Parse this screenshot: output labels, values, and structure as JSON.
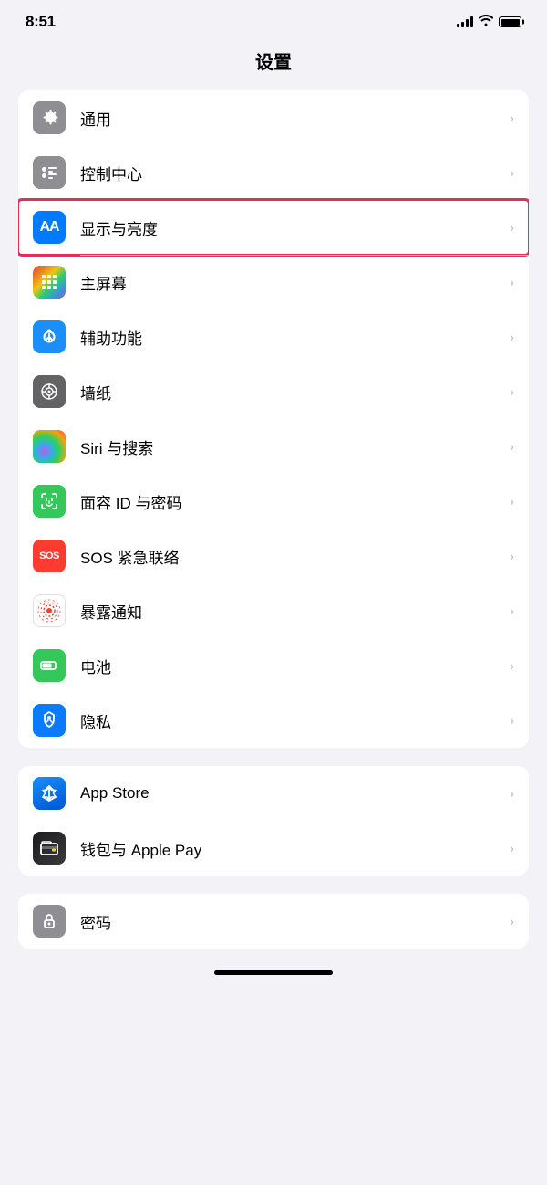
{
  "statusBar": {
    "time": "8:51"
  },
  "pageTitle": "设置",
  "group1": {
    "items": [
      {
        "id": "general",
        "label": "通用",
        "iconColor": "gray",
        "iconType": "gear",
        "highlighted": false
      },
      {
        "id": "control-center",
        "label": "控制中心",
        "iconColor": "gray",
        "iconType": "sliders",
        "highlighted": false
      },
      {
        "id": "display",
        "label": "显示与亮度",
        "iconColor": "blue",
        "iconType": "aa",
        "highlighted": true
      },
      {
        "id": "home-screen",
        "label": "主屏幕",
        "iconColor": "multicolor",
        "iconType": "grid",
        "highlighted": false
      },
      {
        "id": "accessibility",
        "label": "辅助功能",
        "iconColor": "blue2",
        "iconType": "accessibility",
        "highlighted": false
      },
      {
        "id": "wallpaper",
        "label": "墙纸",
        "iconColor": "gray2",
        "iconType": "flower",
        "highlighted": false
      },
      {
        "id": "siri",
        "label": "Siri 与搜索",
        "iconColor": "siri",
        "iconType": "siri",
        "highlighted": false
      },
      {
        "id": "faceid",
        "label": "面容 ID 与密码",
        "iconColor": "green",
        "iconType": "faceid",
        "highlighted": false
      },
      {
        "id": "sos",
        "label": "SOS 紧急联络",
        "iconColor": "red",
        "iconType": "sos",
        "highlighted": false
      },
      {
        "id": "exposure",
        "label": "暴露通知",
        "iconColor": "red2",
        "iconType": "exposure",
        "highlighted": false
      },
      {
        "id": "battery",
        "label": "电池",
        "iconColor": "green2",
        "iconType": "battery",
        "highlighted": false
      },
      {
        "id": "privacy",
        "label": "隐私",
        "iconColor": "blue3",
        "iconType": "hand",
        "highlighted": false
      }
    ]
  },
  "group2": {
    "items": [
      {
        "id": "appstore",
        "label": "App Store",
        "iconColor": "appstore",
        "iconType": "appstore",
        "highlighted": false
      },
      {
        "id": "wallet",
        "label": "钱包与 Apple Pay",
        "iconColor": "wallet",
        "iconType": "wallet",
        "highlighted": false
      }
    ]
  },
  "group3": {
    "items": [
      {
        "id": "passwords",
        "label": "密码",
        "iconColor": "gray",
        "iconType": "password",
        "highlighted": false
      }
    ]
  }
}
